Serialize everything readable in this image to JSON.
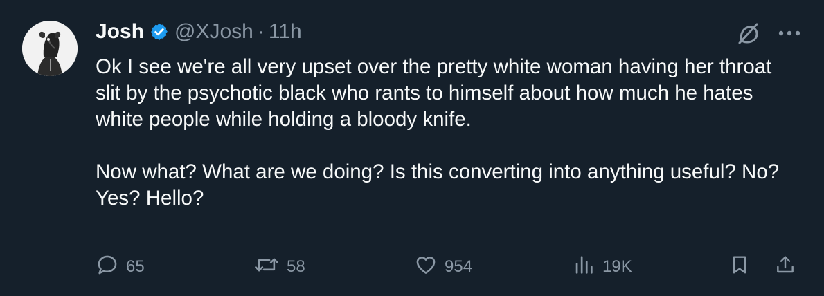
{
  "tweet": {
    "author": {
      "name": "Josh",
      "handle": "@XJosh",
      "verified": true,
      "verified_color": "#1d9bf0"
    },
    "separator": "·",
    "time": "11h",
    "text": "Ok I see we're all very upset over the pretty white woman having her throat slit by the psychotic black who rants to himself about how much he hates white people while holding a bloody knife.\n\nNow what? What are we doing? Is this converting into anything useful? No? Yes? Hello?",
    "stats": {
      "replies": "65",
      "reposts": "58",
      "likes": "954",
      "views": "19K"
    }
  },
  "icons": {
    "avatar": "avatar-rat-portrait",
    "verified": "verified-badge-icon",
    "grok": "grok-icon",
    "more": "more-icon",
    "reply": "reply-icon",
    "repost": "repost-icon",
    "like": "heart-icon",
    "views": "views-icon",
    "bookmark": "bookmark-icon",
    "share": "share-icon"
  },
  "colors": {
    "background": "#15202b",
    "text_primary": "#f7f9f9",
    "text_secondary": "#8b98a5",
    "accent": "#1d9bf0"
  }
}
